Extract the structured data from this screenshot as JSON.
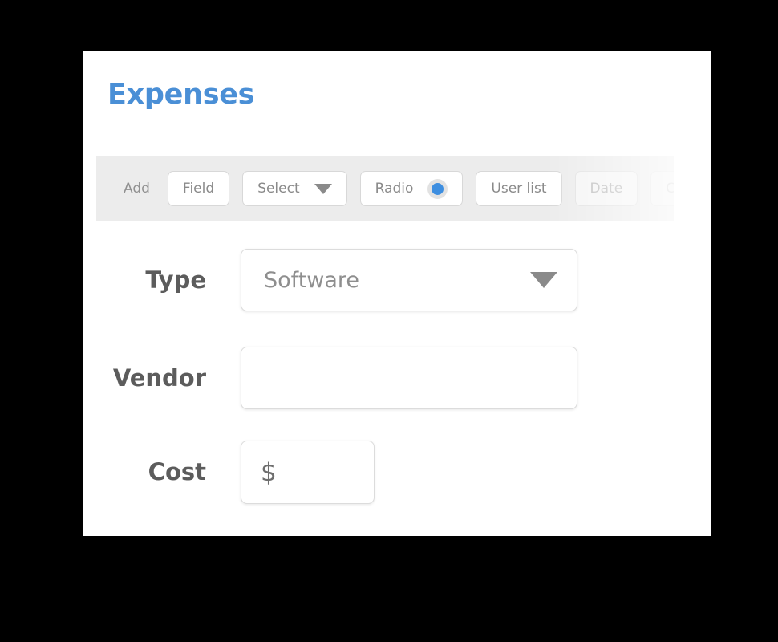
{
  "page": {
    "title": "Expenses",
    "title_color": "#4a8fd6",
    "background_color": "#000000",
    "card_background": "#ffffff"
  },
  "toolbar": {
    "background_color": "#ececec",
    "add_label": "Add",
    "buttons": [
      {
        "label": "Field",
        "icon": null,
        "opacity": "full"
      },
      {
        "label": "Select",
        "icon": "caret-down-icon",
        "opacity": "full"
      },
      {
        "label": "Radio",
        "icon": "radio-selected-icon",
        "opacity": "full"
      },
      {
        "label": "User list",
        "icon": null,
        "opacity": "full"
      },
      {
        "label": "Date",
        "icon": null,
        "opacity": "faded"
      },
      {
        "label": "Currency",
        "icon": null,
        "opacity": "more-faded"
      }
    ],
    "radio_dot_color": "#3d8ee0"
  },
  "form": {
    "rows": [
      {
        "label": "Type",
        "value": "Software",
        "placeholder": "",
        "control": "select"
      },
      {
        "label": "Vendor",
        "value": "",
        "placeholder": "",
        "control": "text"
      },
      {
        "label": "Cost",
        "value": "",
        "prefix": "$",
        "control": "currency"
      }
    ]
  }
}
